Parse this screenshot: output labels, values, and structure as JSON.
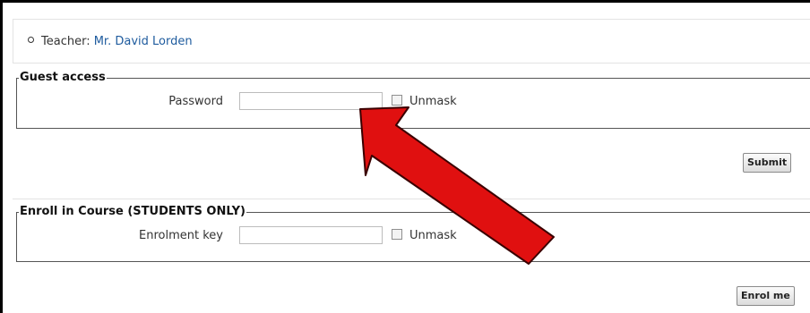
{
  "teacher": {
    "label": "Teacher: ",
    "name": "Mr. David Lorden"
  },
  "guest_access": {
    "legend": "Guest access",
    "password_label": "Password",
    "password_value": "",
    "unmask_label": "Unmask",
    "submit_label": "Submit"
  },
  "enrol": {
    "legend": "Enroll in Course (STUDENTS ONLY)",
    "key_label": "Enrolment key",
    "key_value": "",
    "unmask_label": "Unmask",
    "submit_label": "Enrol me"
  },
  "annotation": {
    "icon": "red-arrow",
    "color": "#e01010"
  }
}
